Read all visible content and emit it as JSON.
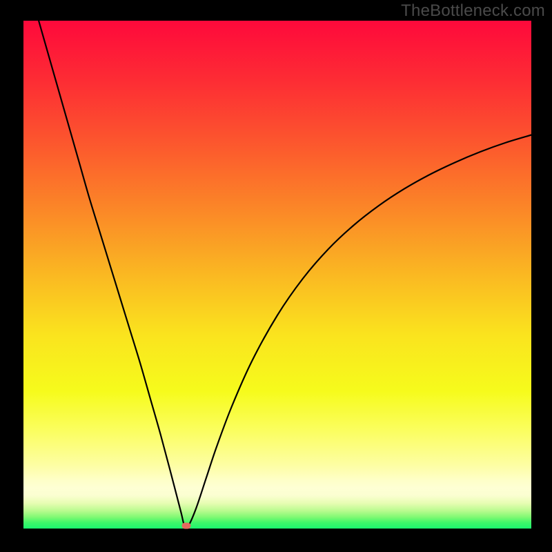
{
  "watermark": "TheBottleneck.com",
  "chart_data": {
    "type": "line",
    "title": "",
    "xlabel": "",
    "ylabel": "",
    "xlim": [
      0,
      100
    ],
    "ylim": [
      0,
      100
    ],
    "grid": false,
    "legend": false,
    "series": [
      {
        "name": "bottleneck-curve",
        "color": "#000000",
        "x": [
          3,
          5,
          7,
          9,
          11,
          13,
          15,
          17,
          19,
          21,
          23,
          25,
          27,
          29,
          31,
          31.7,
          32.5,
          34,
          36,
          38,
          41,
          45,
          50,
          55,
          60,
          65,
          70,
          75,
          80,
          85,
          90,
          95,
          100
        ],
        "values": [
          100,
          93,
          86,
          79,
          72,
          65,
          58.5,
          52,
          45.5,
          39,
          32.5,
          25.5,
          18.5,
          11,
          3.3,
          0.6,
          0.6,
          4,
          10,
          16,
          24,
          33,
          42,
          49.2,
          55,
          59.7,
          63.6,
          66.9,
          69.7,
          72.1,
          74.2,
          76,
          77.5
        ]
      }
    ],
    "annotations": [
      {
        "name": "optimal-point",
        "x": 32,
        "y": 0.6,
        "color": "#e5695e"
      }
    ],
    "background_gradient": {
      "stops": [
        {
          "offset": 0.0,
          "color": "#fe093b"
        },
        {
          "offset": 0.12,
          "color": "#fd2d34"
        },
        {
          "offset": 0.25,
          "color": "#fc5a2d"
        },
        {
          "offset": 0.38,
          "color": "#fb8a27"
        },
        {
          "offset": 0.5,
          "color": "#fab822"
        },
        {
          "offset": 0.62,
          "color": "#fae41e"
        },
        {
          "offset": 0.73,
          "color": "#f6fb1c"
        },
        {
          "offset": 0.81,
          "color": "#fbfe62"
        },
        {
          "offset": 0.875,
          "color": "#fdfea3"
        },
        {
          "offset": 0.905,
          "color": "#feffc8"
        },
        {
          "offset": 0.92,
          "color": "#feffd4"
        },
        {
          "offset": 0.935,
          "color": "#fbfed1"
        },
        {
          "offset": 0.95,
          "color": "#e7fdb3"
        },
        {
          "offset": 0.965,
          "color": "#bafb8f"
        },
        {
          "offset": 0.978,
          "color": "#7df972"
        },
        {
          "offset": 0.988,
          "color": "#40f769"
        },
        {
          "offset": 1.0,
          "color": "#1bf56e"
        }
      ]
    }
  }
}
